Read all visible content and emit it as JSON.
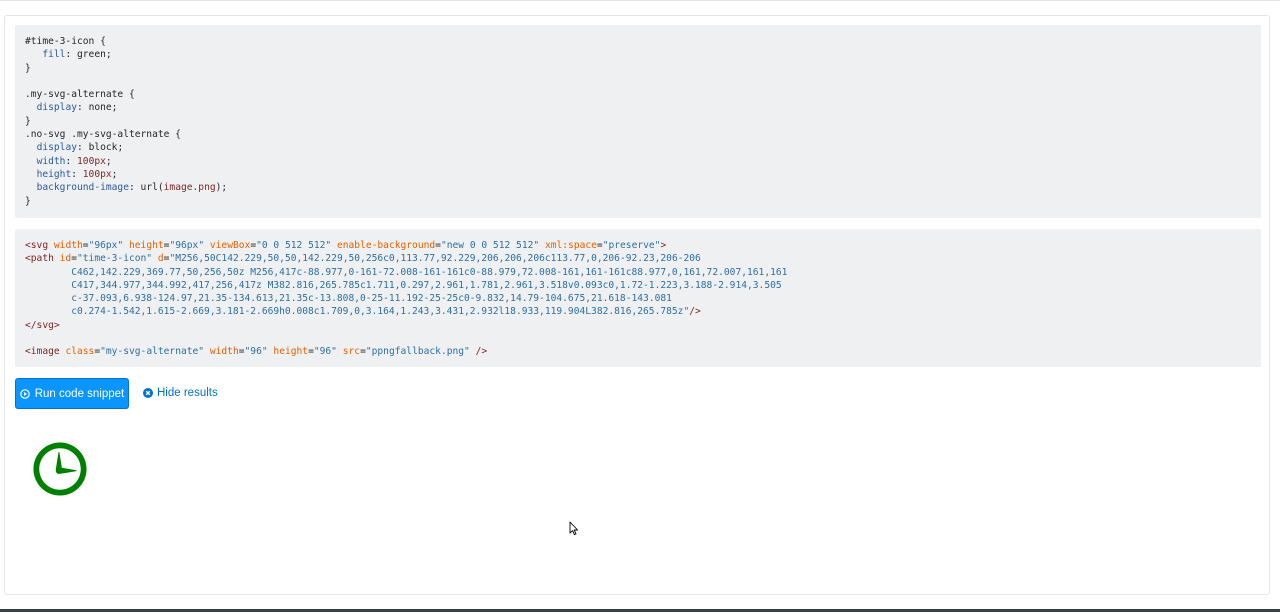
{
  "code": {
    "css_lines": [
      [
        [
          "c-sel",
          "#time-3-icon {"
        ]
      ],
      [
        [
          "c-punc",
          "   "
        ],
        [
          "c-prop",
          "fill"
        ],
        [
          "c-punc",
          ": "
        ],
        [
          "c-val",
          "green;"
        ]
      ],
      [
        [
          "c-sel",
          "}"
        ]
      ],
      [
        [
          "c-punc",
          ""
        ]
      ],
      [
        [
          "c-sel",
          ".my-svg-alternate {"
        ]
      ],
      [
        [
          "c-punc",
          "  "
        ],
        [
          "c-prop",
          "display"
        ],
        [
          "c-punc",
          ": "
        ],
        [
          "c-val",
          "none;"
        ]
      ],
      [
        [
          "c-sel",
          "}"
        ]
      ],
      [
        [
          "c-sel",
          ".no-svg .my-svg-alternate {"
        ]
      ],
      [
        [
          "c-punc",
          "  "
        ],
        [
          "c-prop",
          "display"
        ],
        [
          "c-punc",
          ": "
        ],
        [
          "c-val",
          "block;"
        ]
      ],
      [
        [
          "c-punc",
          "  "
        ],
        [
          "c-prop",
          "width"
        ],
        [
          "c-punc",
          ": "
        ],
        [
          "c-num",
          "100px"
        ],
        [
          "c-val",
          ";"
        ]
      ],
      [
        [
          "c-punc",
          "  "
        ],
        [
          "c-prop",
          "height"
        ],
        [
          "c-punc",
          ": "
        ],
        [
          "c-num",
          "100px"
        ],
        [
          "c-val",
          ";"
        ]
      ],
      [
        [
          "c-punc",
          "  "
        ],
        [
          "c-prop",
          "background-image"
        ],
        [
          "c-punc",
          ": "
        ],
        [
          "c-val",
          "url("
        ],
        [
          "c-num",
          "image.png"
        ],
        [
          "c-val",
          ");"
        ]
      ],
      [
        [
          "c-sel",
          "}"
        ]
      ]
    ],
    "html_lines": [
      [
        [
          "c-tag",
          "<svg "
        ],
        [
          "c-attr",
          "width"
        ],
        [
          "c-punc",
          "="
        ],
        [
          "c-str",
          "\"96px\""
        ],
        [
          "c-punc",
          " "
        ],
        [
          "c-attr",
          "height"
        ],
        [
          "c-punc",
          "="
        ],
        [
          "c-str",
          "\"96px\""
        ],
        [
          "c-punc",
          " "
        ],
        [
          "c-attr",
          "viewBox"
        ],
        [
          "c-punc",
          "="
        ],
        [
          "c-str",
          "\"0 0 512 512\""
        ],
        [
          "c-punc",
          " "
        ],
        [
          "c-attr",
          "enable-background"
        ],
        [
          "c-punc",
          "="
        ],
        [
          "c-str",
          "\"new 0 0 512 512\""
        ],
        [
          "c-punc",
          " "
        ],
        [
          "c-attr",
          "xml:space"
        ],
        [
          "c-punc",
          "="
        ],
        [
          "c-str",
          "\"preserve\""
        ],
        [
          "c-tag",
          ">"
        ]
      ],
      [
        [
          "c-tag",
          "<path "
        ],
        [
          "c-attr",
          "id"
        ],
        [
          "c-punc",
          "="
        ],
        [
          "c-str",
          "\"time-3-icon\""
        ],
        [
          "c-punc",
          " "
        ],
        [
          "c-attr",
          "d"
        ],
        [
          "c-punc",
          "="
        ],
        [
          "c-str",
          "\"M256,50C142.229,50,50,142.229,50,256c0,113.77,92.229,206,206,206c113.77,0,206-92.23,206-206"
        ]
      ],
      [
        [
          "c-str",
          "        C462,142.229,369.77,50,256,50z M256,417c-88.977,0-161-72.008-161-161c0-88.979,72.008-161,161-161c88.977,0,161,72.007,161,161"
        ]
      ],
      [
        [
          "c-str",
          "        C417,344.977,344.992,417,256,417z M382.816,265.785c1.711,0.297,2.961,1.781,2.961,3.518v0.093c0,1.72-1.223,3.188-2.914,3.505"
        ]
      ],
      [
        [
          "c-str",
          "        c-37.093,6.938-124.97,21.35-134.613,21.35c-13.808,0-25-11.192-25-25c0-9.832,14.79-104.675,21.618-143.081"
        ]
      ],
      [
        [
          "c-str",
          "        c0.274-1.542,1.615-2.669,3.181-2.669h0.008c1.709,0,3.164,1.243,3.431,2.932l18.933,119.904L382.816,265.785z\""
        ],
        [
          "c-tag",
          "/>"
        ]
      ],
      [
        [
          "c-tag",
          "</svg>"
        ]
      ],
      [
        [
          "c-punc",
          ""
        ]
      ],
      [
        [
          "c-tag",
          "<image "
        ],
        [
          "c-attr",
          "class"
        ],
        [
          "c-punc",
          "="
        ],
        [
          "c-str",
          "\"my-svg-alternate\""
        ],
        [
          "c-punc",
          " "
        ],
        [
          "c-attr",
          "width"
        ],
        [
          "c-punc",
          "="
        ],
        [
          "c-str",
          "\"96\""
        ],
        [
          "c-punc",
          " "
        ],
        [
          "c-attr",
          "height"
        ],
        [
          "c-punc",
          "="
        ],
        [
          "c-str",
          "\"96\""
        ],
        [
          "c-punc",
          " "
        ],
        [
          "c-attr",
          "src"
        ],
        [
          "c-punc",
          "="
        ],
        [
          "c-str",
          "\"ppngfallback.png\""
        ],
        [
          "c-punc",
          " "
        ],
        [
          "c-tag",
          "/>"
        ]
      ]
    ]
  },
  "actions": {
    "run_label": "Run code snippet",
    "hide_label": "Hide results"
  },
  "icons": {
    "run": "play-circle-icon",
    "hide": "close-circle-icon",
    "result": "clock-icon",
    "cursor": "mouse-pointer-icon"
  },
  "colors": {
    "primary_button": "#0a95ff",
    "link": "#0074cc",
    "clock_fill": "#008000",
    "code_bg": "#eff0f1"
  }
}
